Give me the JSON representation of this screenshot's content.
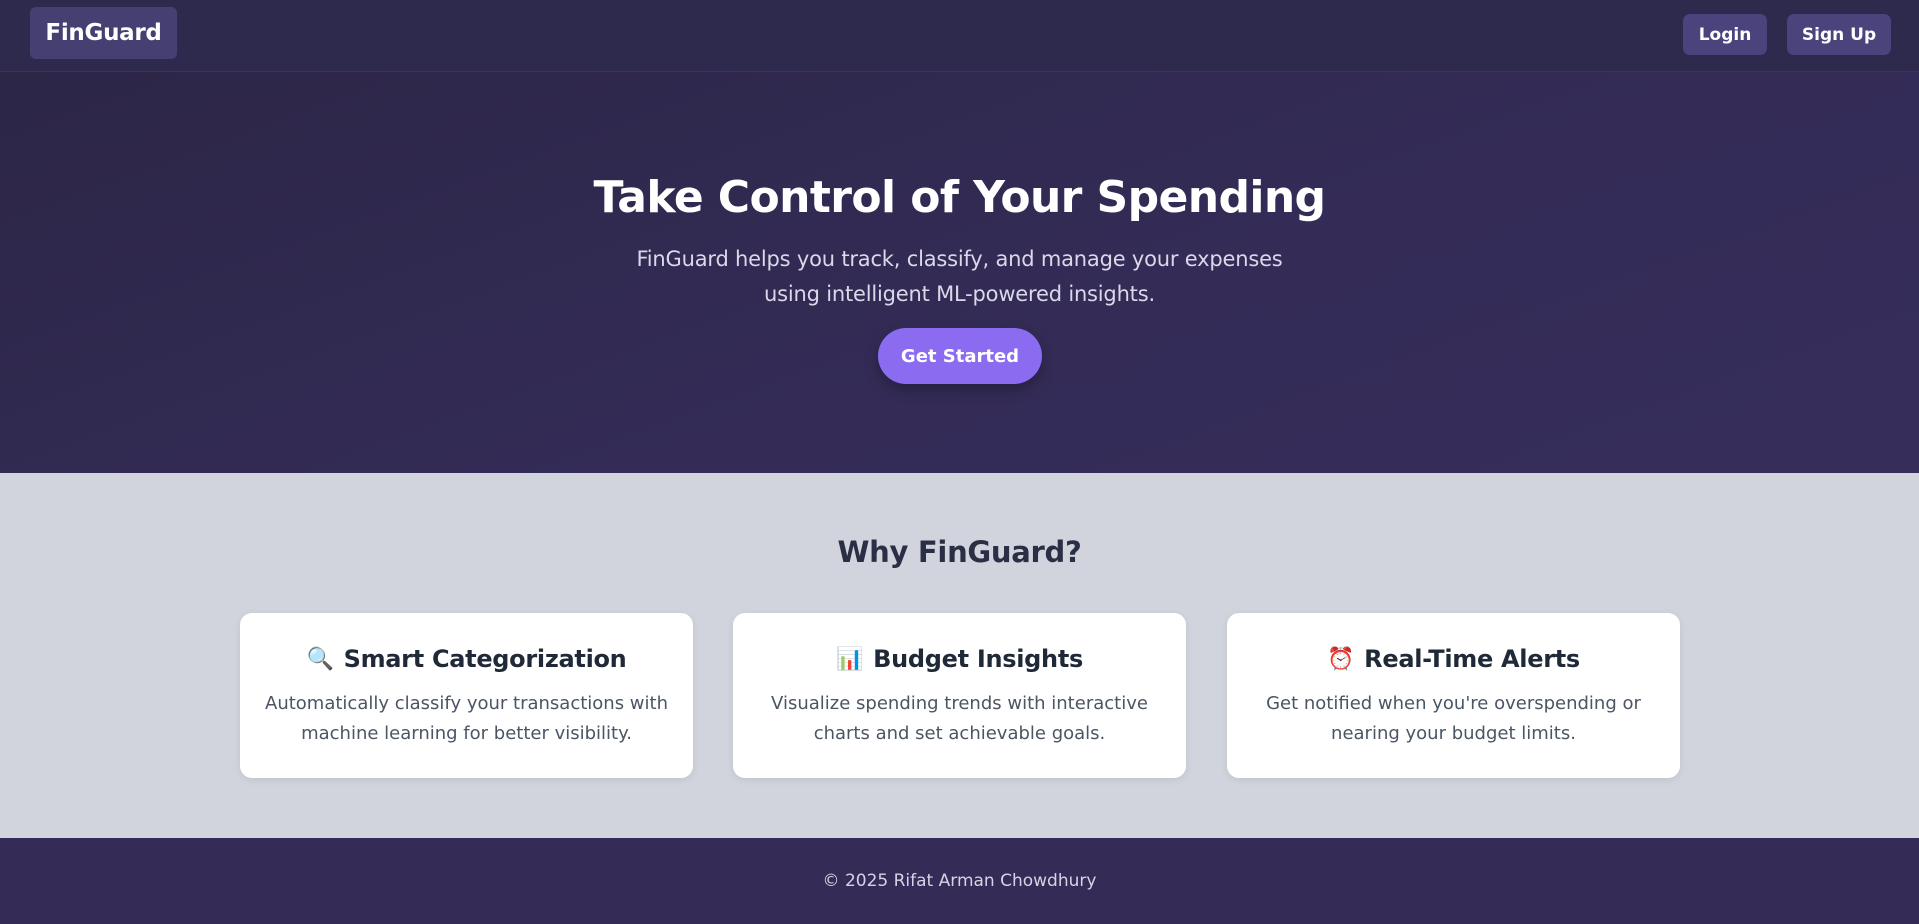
{
  "nav": {
    "brand": "FinGuard",
    "login_label": "Login",
    "signup_label": "Sign Up"
  },
  "hero": {
    "title": "Take Control of Your Spending",
    "subtitle": "FinGuard helps you track, classify, and manage your expenses using intelligent ML-powered insights.",
    "cta_label": "Get Started"
  },
  "features": {
    "title": "Why FinGuard?",
    "cards": [
      {
        "icon": "magnifier-icon",
        "glyph": "🔍",
        "title": "Smart Categorization",
        "text": "Automatically classify your transactions with machine learning for better visibility."
      },
      {
        "icon": "bar-chart-icon",
        "glyph": "📊",
        "title": "Budget Insights",
        "text": "Visualize spending trends with interactive charts and set achievable goals."
      },
      {
        "icon": "alarm-clock-icon",
        "glyph": "⏰",
        "title": "Real-Time Alerts",
        "text": "Get notified when you're overspending or nearing your budget limits."
      }
    ]
  },
  "footer": {
    "text": "© 2025 Rifat Arman Chowdhury"
  },
  "colors": {
    "nav_bg": "#2e2a4e",
    "hero_bg": "#342c57",
    "accent": "#8b6cf1",
    "section_bg": "#d1d4dc",
    "card_bg": "#ffffff"
  }
}
